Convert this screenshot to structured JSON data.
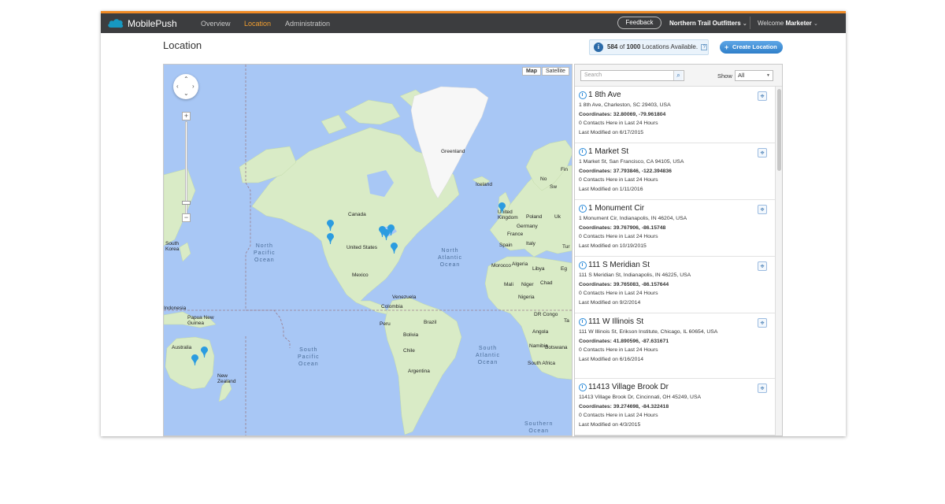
{
  "header": {
    "app_name": "MobilePush",
    "nav": [
      "Overview",
      "Location",
      "Administration"
    ],
    "active_nav": "Location",
    "feedback_label": "Feedback",
    "org_name": "Northern Trail Outfitters",
    "welcome_label": "Welcome",
    "user_name": "Marketer",
    "accent_color": "#f08a24",
    "icons": [
      "salesforce-cloud-icon",
      "chevron-down-icon"
    ]
  },
  "page": {
    "title": "Location",
    "availability": {
      "used": "584",
      "of_label": "of",
      "total": "1000",
      "suffix": "Locations Available.",
      "help": "?"
    },
    "create_button": "Create Location",
    "create_button_icon": "+"
  },
  "map": {
    "types": [
      "Map",
      "Satellite"
    ],
    "selected_type": "Map",
    "zoom_in": "+",
    "zoom_out": "−",
    "zoom_level": 0.15,
    "water_color": "#a8c7f5",
    "land_color": "#d7e9c4",
    "pin_color": "#2b9ce0",
    "labels": {
      "greenland": "Greenland",
      "iceland": "Iceland",
      "canada": "Canada",
      "united_states": "United States",
      "mexico": "Mexico",
      "united_kingdom": "United\nKingdom",
      "france": "France",
      "spain": "Spain",
      "morocco": "Morocco",
      "algeria": "Algeria",
      "libya": "Libya",
      "egypt": "Eg",
      "mali": "Mali",
      "niger": "Niger",
      "chad": "Chad",
      "nigeria": "Nigeria",
      "drc": "DR Congo",
      "angola": "Angola",
      "namibia": "Namibia",
      "botswana": "Botswana",
      "south_africa": "South Africa",
      "tanzania": "Ta",
      "norway": "No",
      "sweden": "Sw",
      "finland": "Fin",
      "poland": "Poland",
      "ukraine": "Uk",
      "germany": "Germany",
      "italy": "Italy",
      "turkey": "Tur",
      "venezuela": "Venezuela",
      "colombia": "Colombia",
      "peru": "Peru",
      "brazil": "Brazil",
      "bolivia": "Bolivia",
      "chile": "Chile",
      "argentina": "Argentina",
      "south_korea": "South\nKorea",
      "indonesia": "Indonesia",
      "papua_new_guinea": "Papua New\nGuinea",
      "australia": "Australia",
      "new_zealand": "New\nZealand",
      "north_pacific": "North\nPacific\nOcean",
      "north_atlantic": "North\nAtlantic\nOcean",
      "south_pacific": "South\nPacific\nOcean",
      "south_atlantic": "South\nAtlantic\nOcean",
      "southern": "Southern\nOcean"
    }
  },
  "panel": {
    "search_placeholder": "Search",
    "show_label": "Show",
    "show_value": "All",
    "locations": [
      {
        "name": "1 8th Ave",
        "address": "1 8th Ave, Charleston, SC 29403, USA",
        "coordinates": "Coordinates: 32.80069, -79.961804",
        "contacts": "0 Contacts Here in Last 24 Hours",
        "modified": "Last Modified on 6/17/2015"
      },
      {
        "name": "1 Market St",
        "address": "1 Market St, San Francisco, CA 94105, USA",
        "coordinates": "Coordinates: 37.793846, -122.394836",
        "contacts": "0 Contacts Here in Last 24 Hours",
        "modified": "Last Modified on 1/11/2016"
      },
      {
        "name": "1 Monument Cir",
        "address": "1 Monument Cir, Indianapolis, IN 46204, USA",
        "coordinates": "Coordinates: 39.767906, -86.15748",
        "contacts": "0 Contacts Here in Last 24 Hours",
        "modified": "Last Modified on 10/19/2015"
      },
      {
        "name": "111 S Meridian St",
        "address": "111 S Meridian St, Indianapolis, IN 46225, USA",
        "coordinates": "Coordinates: 39.765083, -86.157644",
        "contacts": "0 Contacts Here in Last 24 Hours",
        "modified": "Last Modified on 9/2/2014"
      },
      {
        "name": "111 W Illinois St",
        "address": "111 W Illinois St, Erikson Institute, Chicago, IL 60654, USA",
        "coordinates": "Coordinates: 41.890596, -87.631671",
        "contacts": "0 Contacts Here in Last 24 Hours",
        "modified": "Last Modified on 6/16/2014"
      },
      {
        "name": "11413 Village Brook Dr",
        "address": "11413 Village Brook Dr, Cincinnati, OH 45249, USA",
        "coordinates": "Coordinates: 39.274698, -84.322418",
        "contacts": "0 Contacts Here in Last 24 Hours",
        "modified": "Last Modified on 4/3/2015"
      }
    ]
  }
}
